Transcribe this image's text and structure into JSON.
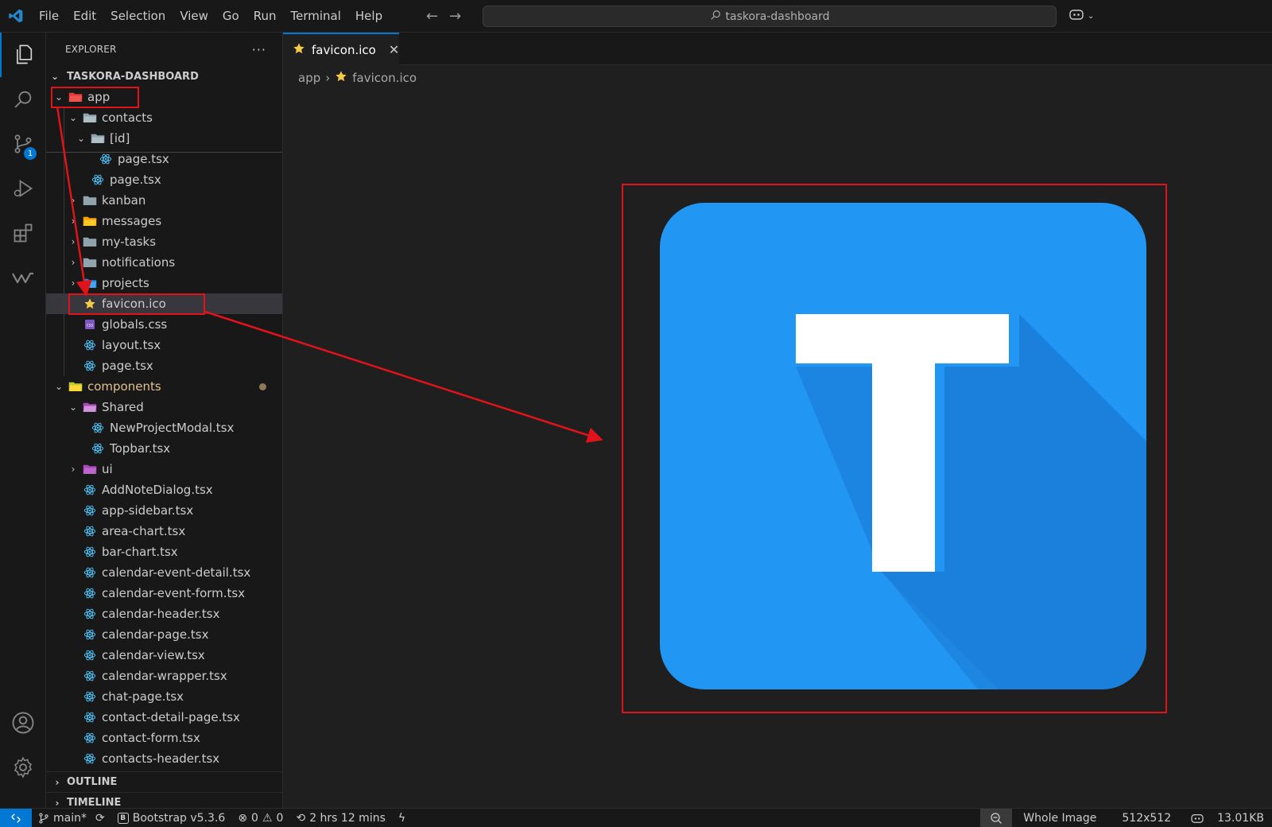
{
  "titlebar": {
    "menu": [
      "File",
      "Edit",
      "Selection",
      "View",
      "Go",
      "Run",
      "Terminal",
      "Help"
    ],
    "search_text": "taskora-dashboard"
  },
  "activity": {
    "scm_badge": "1"
  },
  "explorer": {
    "header": "EXPLORER",
    "more": "···",
    "root": "TASKORA-DASHBOARD",
    "items": [
      {
        "label": "app",
        "indent": 1,
        "chev": "open",
        "icon": "folder-app-icon"
      },
      {
        "label": "contacts",
        "indent": 2,
        "chev": "open",
        "icon": "folder-open-icon"
      },
      {
        "label": "[id]",
        "indent": 3,
        "chev": "open",
        "icon": "folder-open-icon"
      },
      {
        "label": "page.tsx",
        "indent": 4,
        "chev": "none",
        "icon": "react-icon"
      },
      {
        "label": "page.tsx",
        "indent": 3,
        "chev": "none",
        "icon": "react-icon"
      },
      {
        "label": "kanban",
        "indent": 2,
        "chev": "closed",
        "icon": "folder-icon"
      },
      {
        "label": "messages",
        "indent": 2,
        "chev": "closed",
        "icon": "folder-messages-icon"
      },
      {
        "label": "my-tasks",
        "indent": 2,
        "chev": "closed",
        "icon": "folder-icon"
      },
      {
        "label": "notifications",
        "indent": 2,
        "chev": "closed",
        "icon": "folder-icon"
      },
      {
        "label": "projects",
        "indent": 2,
        "chev": "closed",
        "icon": "folder-projects-icon"
      },
      {
        "label": "favicon.ico",
        "indent": 2,
        "chev": "none",
        "icon": "star-icon",
        "selected": true
      },
      {
        "label": "globals.css",
        "indent": 2,
        "chev": "none",
        "icon": "css-icon"
      },
      {
        "label": "layout.tsx",
        "indent": 2,
        "chev": "none",
        "icon": "react-icon"
      },
      {
        "label": "page.tsx",
        "indent": 2,
        "chev": "none",
        "icon": "react-icon"
      },
      {
        "label": "components",
        "indent": 1,
        "chev": "open",
        "icon": "folder-components-icon",
        "modified": true
      },
      {
        "label": "Shared",
        "indent": 2,
        "chev": "open",
        "icon": "folder-shared-icon"
      },
      {
        "label": "NewProjectModal.tsx",
        "indent": 3,
        "chev": "none",
        "icon": "react-icon"
      },
      {
        "label": "Topbar.tsx",
        "indent": 3,
        "chev": "none",
        "icon": "react-icon"
      },
      {
        "label": "ui",
        "indent": 2,
        "chev": "closed",
        "icon": "folder-ui-icon"
      },
      {
        "label": "AddNoteDialog.tsx",
        "indent": 2,
        "chev": "none",
        "icon": "react-icon"
      },
      {
        "label": "app-sidebar.tsx",
        "indent": 2,
        "chev": "none",
        "icon": "react-icon"
      },
      {
        "label": "area-chart.tsx",
        "indent": 2,
        "chev": "none",
        "icon": "react-icon"
      },
      {
        "label": "bar-chart.tsx",
        "indent": 2,
        "chev": "none",
        "icon": "react-icon"
      },
      {
        "label": "calendar-event-detail.tsx",
        "indent": 2,
        "chev": "none",
        "icon": "react-icon"
      },
      {
        "label": "calendar-event-form.tsx",
        "indent": 2,
        "chev": "none",
        "icon": "react-icon"
      },
      {
        "label": "calendar-header.tsx",
        "indent": 2,
        "chev": "none",
        "icon": "react-icon"
      },
      {
        "label": "calendar-page.tsx",
        "indent": 2,
        "chev": "none",
        "icon": "react-icon"
      },
      {
        "label": "calendar-view.tsx",
        "indent": 2,
        "chev": "none",
        "icon": "react-icon"
      },
      {
        "label": "calendar-wrapper.tsx",
        "indent": 2,
        "chev": "none",
        "icon": "react-icon"
      },
      {
        "label": "chat-page.tsx",
        "indent": 2,
        "chev": "none",
        "icon": "react-icon"
      },
      {
        "label": "contact-detail-page.tsx",
        "indent": 2,
        "chev": "none",
        "icon": "react-icon"
      },
      {
        "label": "contact-form.tsx",
        "indent": 2,
        "chev": "none",
        "icon": "react-icon"
      },
      {
        "label": "contacts-header.tsx",
        "indent": 2,
        "chev": "none",
        "icon": "react-icon"
      }
    ],
    "outline": "OUTLINE",
    "timeline": "TIMELINE"
  },
  "editor": {
    "tab_label": "favicon.ico",
    "breadcrumb": [
      "app",
      "favicon.ico"
    ],
    "image_letter": "T"
  },
  "statusbar": {
    "branch": "main*",
    "bootstrap": "Bootstrap v5.3.6",
    "errors": "0",
    "warnings": "0",
    "time": "2 hrs 12 mins",
    "view_mode": "Whole Image",
    "dimensions": "512x512",
    "size": "13.01KB"
  },
  "colors": {
    "accent": "#0078d4",
    "annotation": "#e0131a",
    "favicon_bg": "#2196f3",
    "favicon_shadow": "#1976d2"
  }
}
